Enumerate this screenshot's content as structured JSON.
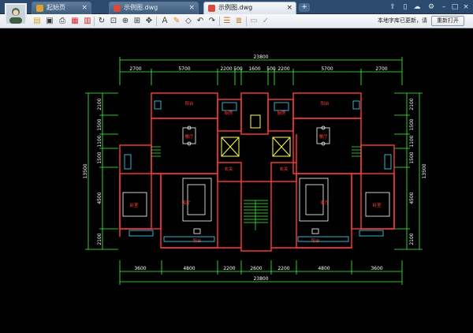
{
  "tabs": [
    {
      "label": "起始页",
      "active": false
    },
    {
      "label": "示例图.dwg",
      "active": false
    },
    {
      "label": "示例图.dwg",
      "active": true
    }
  ],
  "new_tab_label": "+",
  "toolbar_icons": [
    "open-icon",
    "save-icon",
    "print-icon",
    "pdf-icon",
    "undo-icon",
    "rotate-icon",
    "zoom-window-icon",
    "zoom-in-icon",
    "zoom-extent-icon",
    "pan-icon",
    "text-icon",
    "pen-icon",
    "eraser-icon",
    "back-icon",
    "forward-icon",
    "layer-icon",
    "layers-icon",
    "measure-icon",
    "check-icon"
  ],
  "notice": "本地字库已更新，请",
  "reopen_label": "重新打开",
  "drawing": {
    "top_total": "23800",
    "top_dims": [
      "2700",
      "5700",
      "2200",
      "500",
      "1600",
      "500",
      "2200",
      "5700",
      "2700"
    ],
    "bottom_total": "23800",
    "bottom_dims": [
      "3600",
      "4800",
      "2200",
      "2600",
      "2200",
      "4800",
      "3600"
    ],
    "left_dims": [
      "2100",
      "1500",
      "1100",
      "1500",
      "4500",
      "2100"
    ],
    "left_total": "13500",
    "right_dims": [
      "2100",
      "1500",
      "1100",
      "1500",
      "4500",
      "2100"
    ],
    "right_total": "13500",
    "rooms": {
      "balcony_l": "阳台",
      "balcony_r": "阳台",
      "kitchen_l": "厨房",
      "kitchen_r": "厨房",
      "dining_l": "餐厅",
      "dining_r": "餐厅",
      "foyer_l": "玄关",
      "foyer_r": "玄关",
      "bed_l": "卧室",
      "bed_r": "卧室",
      "living_l": "客厅",
      "living_r": "客厅",
      "porch_l": "阳台",
      "porch_r": "阳台"
    }
  },
  "colors": {
    "wall": "#ff3b3b",
    "dim": "#3bff3b",
    "axis": "#ffffff",
    "cyan": "#35e0ff",
    "yellow": "#ffff40"
  }
}
